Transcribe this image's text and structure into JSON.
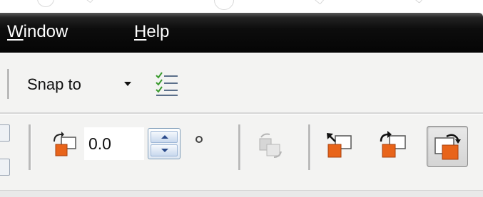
{
  "menu": {
    "items": [
      {
        "label": "Window",
        "mnemonic": "W",
        "rest": "indow"
      },
      {
        "label": "Help",
        "mnemonic": "H",
        "rest": "elp"
      }
    ]
  },
  "toolbar_snap": {
    "snap_label": "Snap to",
    "snap_icon": "chevron-down-icon",
    "checklist_icon": "checklist-icon"
  },
  "toolbar_rotate": {
    "rotation_icon": "rotation-angle-icon",
    "angle_value": "0.0",
    "degree_symbol": "°",
    "icons": {
      "rotate_disabled": "rotate-disabled-icon",
      "rotate_ccw": "rotate-counterclockwise-icon",
      "rotate_cw": "rotate-clockwise-icon",
      "auto_rotate": "auto-rotate-icon"
    },
    "auto_rotate_active": true
  },
  "colors": {
    "menubar": "#0d0d0d",
    "toolbar": "#f3f3f2",
    "accent_orange": "#e8641a"
  }
}
